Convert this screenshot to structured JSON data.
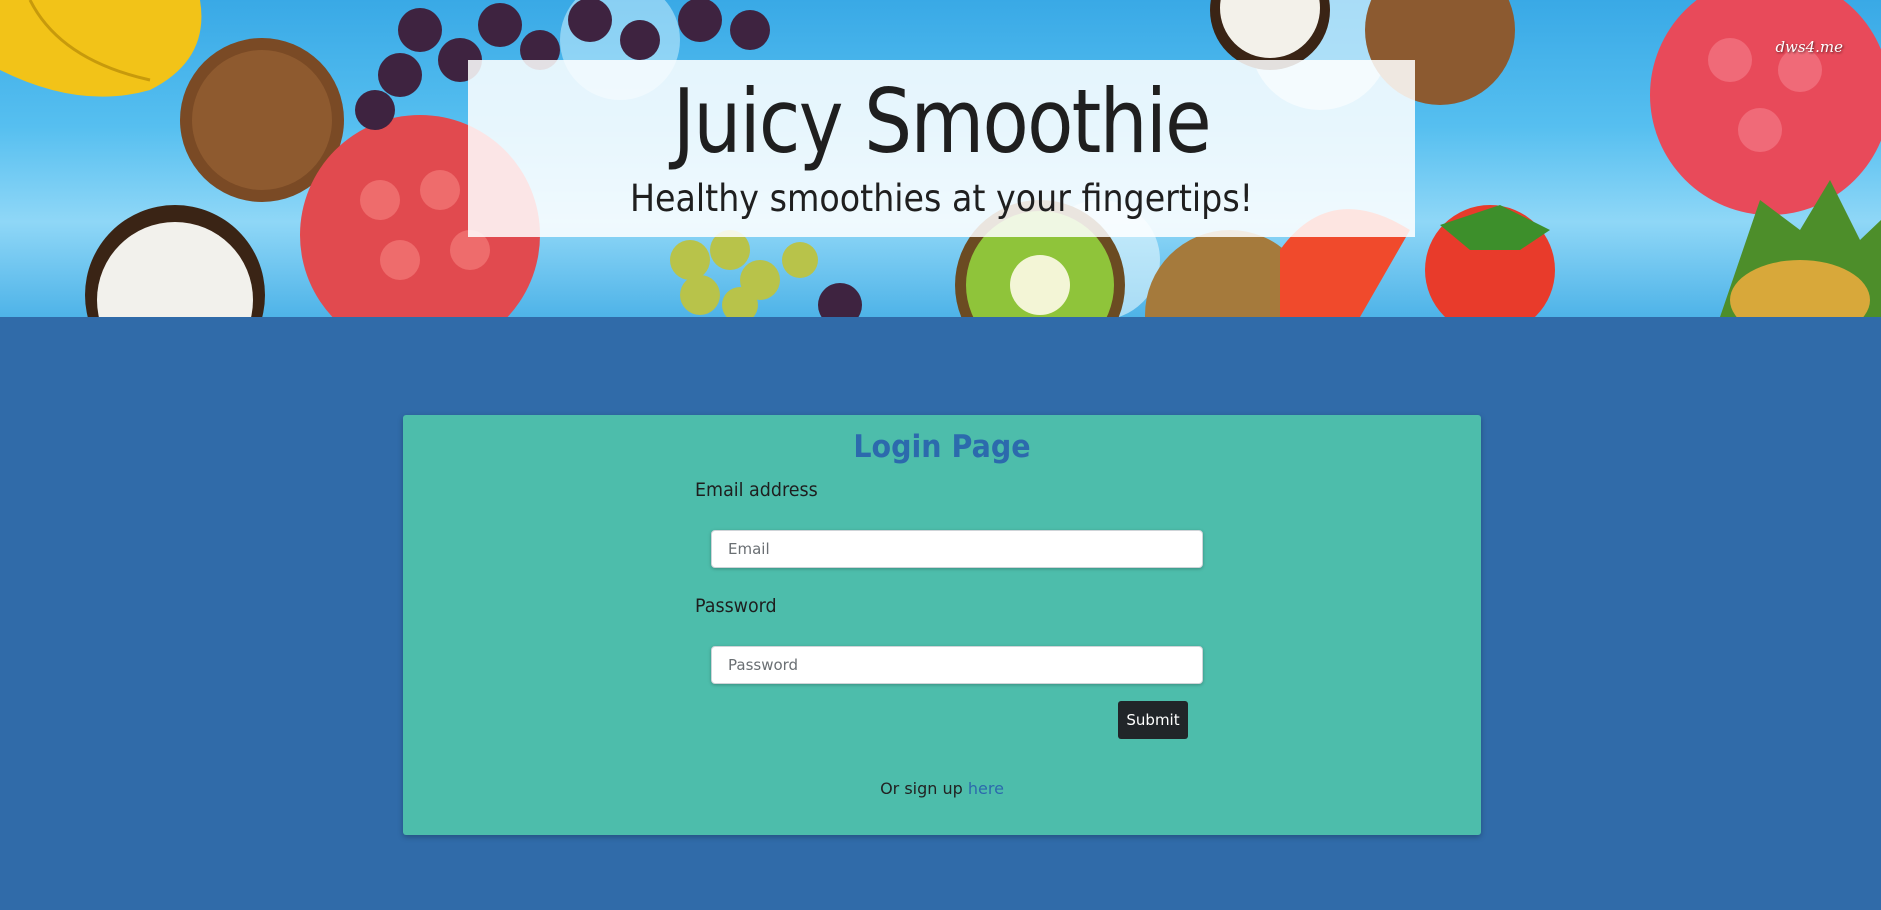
{
  "hero": {
    "title": "Juicy Smoothie",
    "subtitle": "Healthy smoothies at your fingertips!",
    "watermark": "dws4.me"
  },
  "login": {
    "heading": "Login Page",
    "email_label": "Email address",
    "email_placeholder": "Email",
    "password_label": "Password",
    "password_placeholder": "Password",
    "submit_label": "Submit",
    "signup_prefix": "Or sign up",
    "signup_link": "here"
  },
  "colors": {
    "page_background": "#306ba9",
    "card_background": "#4dbdab",
    "accent_blue": "#2c6aad",
    "button_dark": "#212529"
  }
}
